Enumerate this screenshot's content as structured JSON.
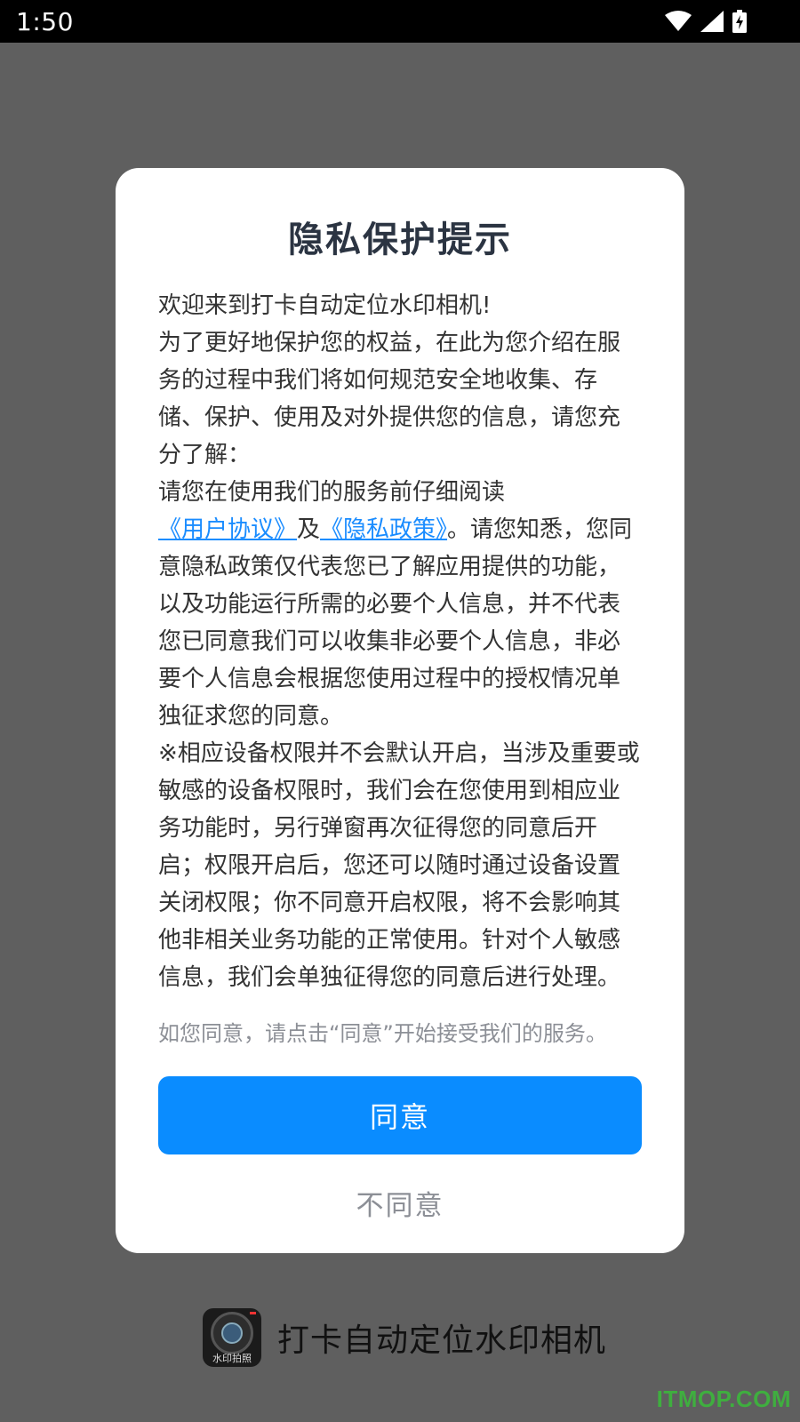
{
  "status_bar": {
    "time": "1:50",
    "icons": [
      "wifi-icon",
      "cell-signal-icon",
      "battery-charging-icon"
    ]
  },
  "dialog": {
    "title": "隐私保护提示",
    "welcome": "欢迎来到打卡自动定位水印相机!",
    "intro": "为了更好地保护您的权益，在此为您介绍在服务的过程中我们将如何规范安全地收集、存储、保护、使用及对外提供您的信息，请您充分了解：",
    "read_prefix": "请您在使用我们的服务前仔细阅读",
    "user_agreement_link": "《用户协议》",
    "and_text": "及",
    "privacy_policy_link": "《隐私政策》",
    "read_suffix": "。请您知悉，您同意隐私政策仅代表您已了解应用提供的功能，以及功能运行所需的必要个人信息，并不代表您已同意我们可以收集非必要个人信息，非必要个人信息会根据您使用过程中的授权情况单独征求您的同意。",
    "permission_note": "※相应设备权限并不会默认开启，当涉及重要或敏感的设备权限时，我们会在您使用到相应业务功能时，另行弹窗再次征得您的同意后开启；权限开启后，您还可以随时通过设备设置关闭权限；你不同意开启权限，将不会影响其他非相关业务功能的正常使用。针对个人敏感信息，我们会单独征得您的同意后进行处理。",
    "consent_hint": "如您同意，请点击“同意”开始接受我们的服务。",
    "agree_label": "同意",
    "disagree_label": "不同意"
  },
  "app_brand": {
    "logo_text": "水印拍照",
    "name": "打卡自动定位水印相机"
  },
  "watermark": "ITMOP.COM",
  "colors": {
    "accent": "#0a8cff",
    "link": "#1a8cff",
    "backdrop": "#5f5f5f",
    "watermark": "#3fae3f"
  }
}
